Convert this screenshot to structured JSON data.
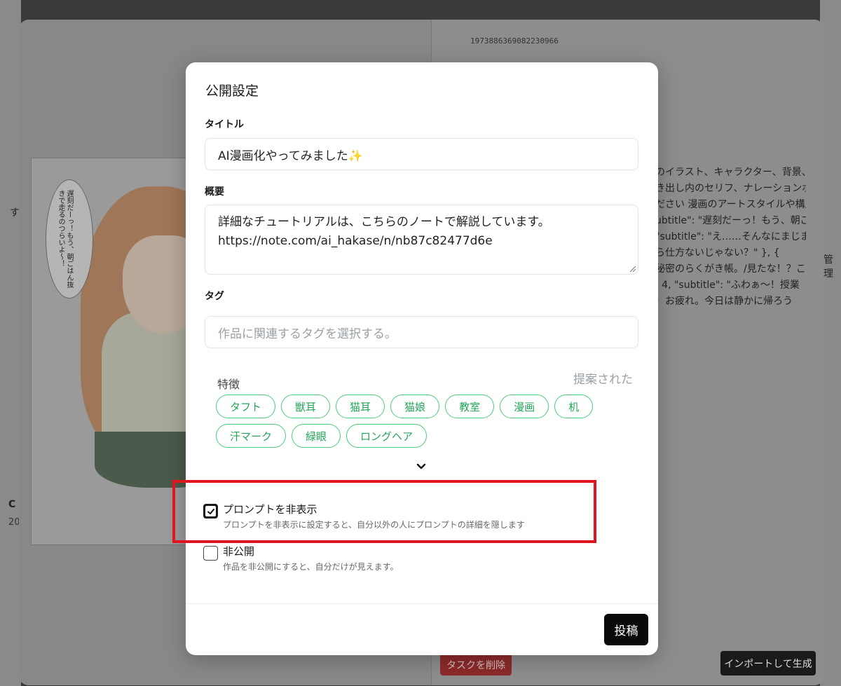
{
  "background": {
    "id_text": "1973886369082230966",
    "side_fragments": [
      "す",
      "C",
      "20"
    ],
    "description_lines": [
      "のイラスト、キャラクター、背景、コマ",
      "き出し内のセリフ、ナレーションボック",
      "ださい 漫画のアートスタイルや構成",
      "ubtitle\": \"遅刻だーっ！もう、朝ご",
      "\"subtitle\": \"え……そんなにまじま",
      "ら仕方ないじゃない？\" }, {",
      "秘密のらくがき帳。/見たな！？これ",
      ": 4, \"subtitle\": \"ふわぁ〜！授業",
      "）お疲れ。今日は静かに帰ろう"
    ],
    "right_edge_fragment": "管理",
    "manga_bubble_text": "遅刻だーっ！もう、朝ごはん抜きで走るのつらいよ〜！",
    "delete_task_button": "タスクを削除",
    "import_generate_button": "インポートして生成"
  },
  "dialog": {
    "title": "公開設定",
    "title_label": "タイトル",
    "title_value": "AI漫画化やってみました✨",
    "summary_label": "概要",
    "summary_line1": "詳細なチュートリアルは、こちらのノートで解説しています。",
    "summary_line2": "https://note.com/ai_hakase/n/nb87c82477d6e",
    "tag_label": "タグ",
    "tag_placeholder": "作品に関連するタグを選択する。",
    "features_heading": "特徴",
    "suggested_label": "提案された",
    "tags": [
      "タフト",
      "獣耳",
      "猫耳",
      "猫娘",
      "教室",
      "漫画",
      "机",
      "汗マーク",
      "緑眼",
      "ロングヘア"
    ],
    "hide_prompt": {
      "label": "プロンプトを非表示",
      "description": "プロンプトを非表示に設定すると、自分以外の人にプロンプトの詳細を隠します",
      "checked": true
    },
    "private": {
      "label": "非公開",
      "description": "作品を非公開にすると、自分だけが見えます。",
      "checked": false
    },
    "post_button": "投稿"
  },
  "colors": {
    "tag_border": "#4ccb7a",
    "tag_text": "#25a55a",
    "highlight": "#e0141e",
    "post_button_bg": "#0a0a0a"
  }
}
